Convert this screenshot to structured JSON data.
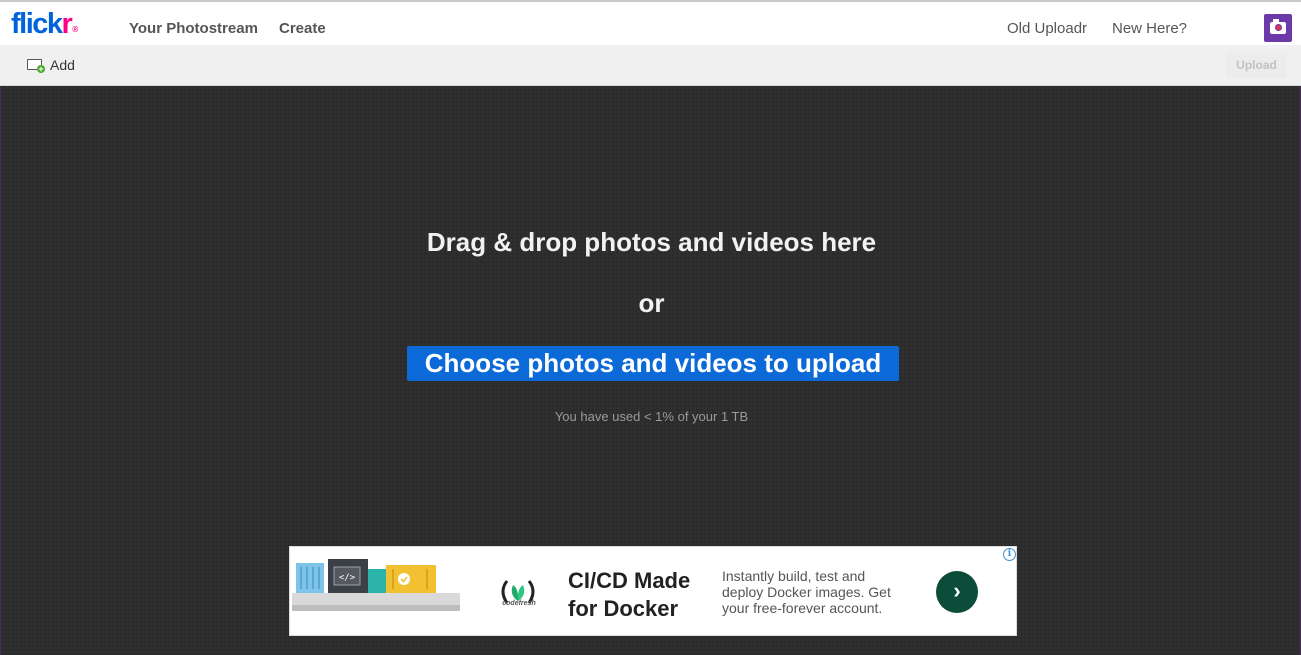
{
  "nav": {
    "logo_main": "flick",
    "logo_accent": "r",
    "logo_dot": "®",
    "your_photostream": "Your Photostream",
    "create": "Create",
    "old_uploadr": "Old Uploadr",
    "new_here": "New Here?"
  },
  "toolbar": {
    "add_label": "Add",
    "upload_label": "Upload"
  },
  "drop": {
    "title": "Drag & drop photos and videos here",
    "or": "or",
    "choose_label": "Choose photos and videos to upload",
    "usage": "You have used < 1% of your 1 TB"
  },
  "ad": {
    "info_glyph": "i",
    "logo_text": "codefresh",
    "headline": "CI/CD Made for Docker",
    "body": "Instantly build, test and deploy Docker images. Get your free-forever account.",
    "arrow_glyph": "›"
  },
  "colors": {
    "flickr_blue": "#0063dc",
    "flickr_pink": "#ff0084",
    "choose_button": "#0b6ad8",
    "ad_cta": "#0c4d3a"
  }
}
